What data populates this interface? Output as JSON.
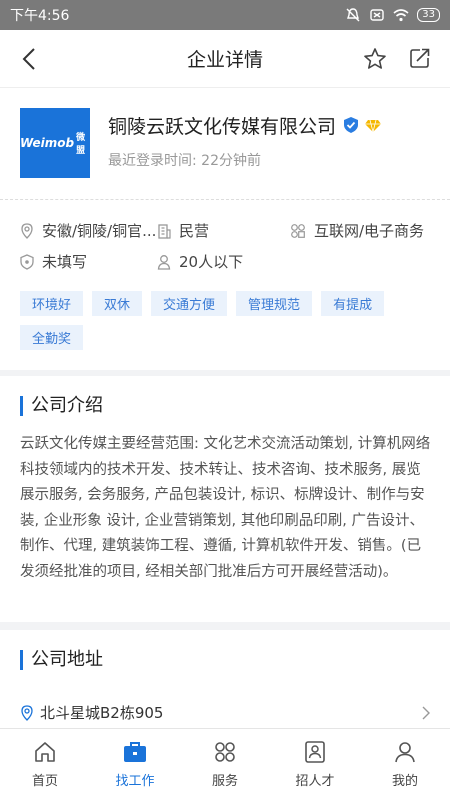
{
  "status_bar": {
    "time": "下午4:56",
    "battery": "33"
  },
  "nav": {
    "title": "企业详情"
  },
  "company": {
    "logo_text": "Weimob",
    "logo_sub": "微盟",
    "name": "铜陵云跃文化传媒有限公司",
    "last_login": "最近登录时间: 22分钟前"
  },
  "info": {
    "location": "安徽/铜陵/铜官...",
    "ownership": "民营",
    "industry": "互联网/电子商务",
    "financing": "未填写",
    "size": "20人以下"
  },
  "tags": [
    "环境好",
    "双休",
    "交通方便",
    "管理规范",
    "有提成",
    "全勤奖"
  ],
  "intro": {
    "title": "公司介绍",
    "text": "云跃文化传媒主要经营范围: 文化艺术交流活动策划, 计算机网络科技领域内的技术开发、技术转让、技术咨询、技术服务, 展览展示服务, 会务服务, 产品包装设计, 标识、标牌设计、制作与安装, 企业形象 设计, 企业营销策划, 其他印刷品印刷, 广告设计、制作、代理, 建筑装饰工程、遵循, 计算机软件开发、销售。(已发须经批准的项目, 经相关部门批准后方可开展经营活动)。"
  },
  "address": {
    "title": "公司地址",
    "value": "北斗星城B2栋905"
  },
  "tabbar": {
    "home": "首页",
    "jobs": "找工作",
    "services": "服务",
    "recruit": "招人才",
    "mine": "我的"
  },
  "colors": {
    "accent": "#1a73d9",
    "tag_bg": "#eaf2fc"
  }
}
